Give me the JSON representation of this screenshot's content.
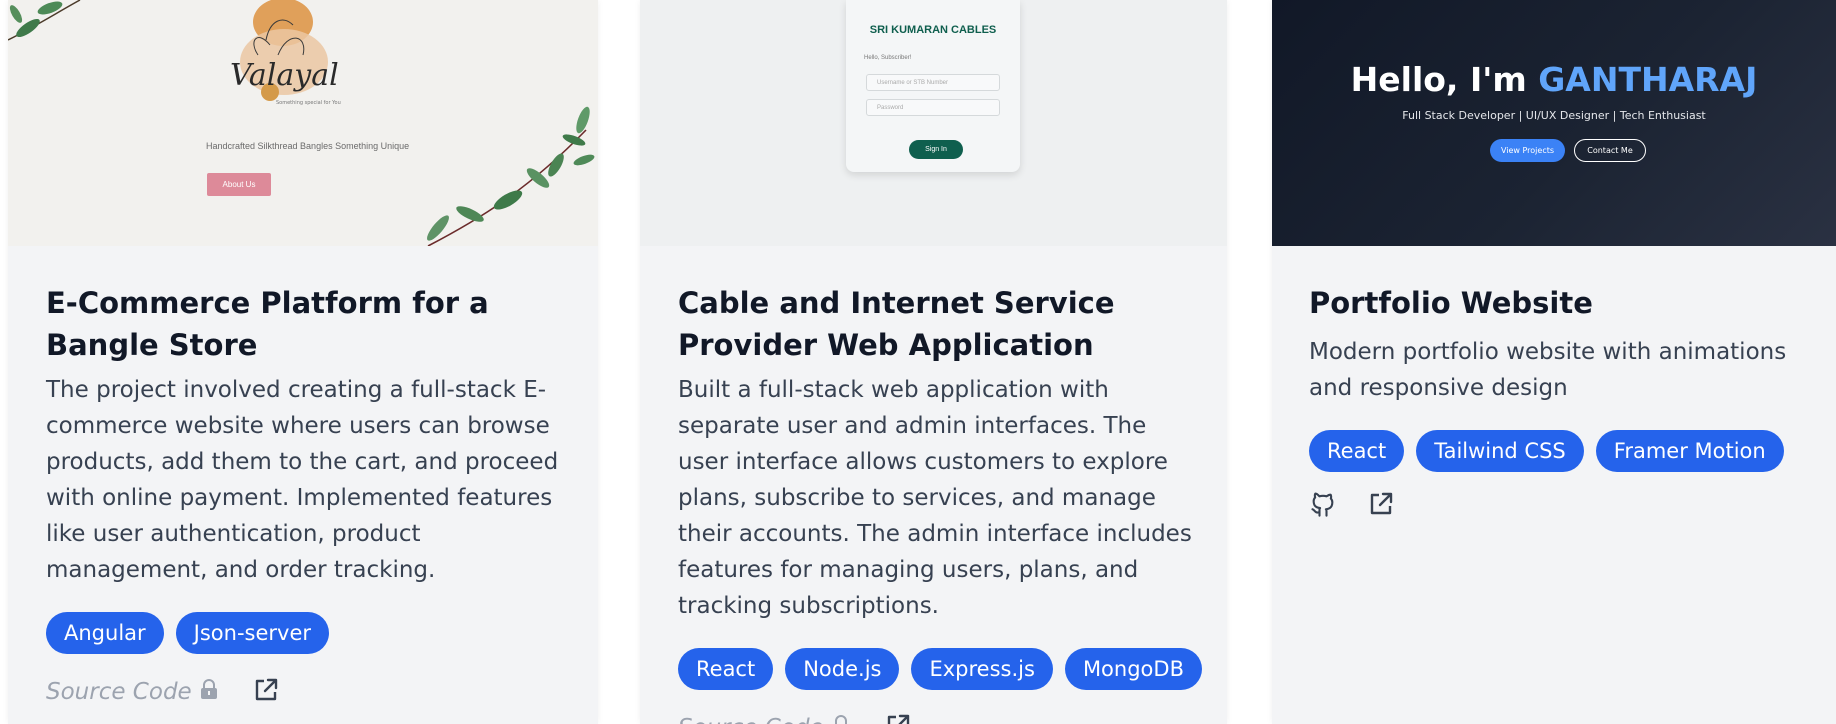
{
  "projects": [
    {
      "title": "E-Commerce Platform for a Bangle Store",
      "description": "The project involved creating a full-stack E-commerce website where users can browse products, add them to the cart, and proceed with online payment. Implemented features like user authentication, product management, and order tracking.",
      "tags": [
        "Angular",
        "Json-server"
      ],
      "source_label": "Source Code",
      "preview": {
        "brand": "Valayal",
        "brand_sub": "Something special for You",
        "tagline": "Handcrafted Silkthread Bangles Something Unique",
        "button": "About Us"
      }
    },
    {
      "title": "Cable and Internet Service Provider Web Application",
      "description": "Built a full-stack web application with separate user and admin interfaces. The user interface allows customers to explore plans, subscribe to services, and manage their accounts. The admin interface includes features for managing users, plans, and tracking subscriptions.",
      "tags": [
        "React",
        "Node.js",
        "Express.js",
        "MongoDB"
      ],
      "source_label": "Source Code",
      "preview": {
        "title": "SRI KUMARAN CABLES",
        "greeting": "Hello, Subscriber!",
        "username_placeholder": "Username or STB Number",
        "password_placeholder": "Password",
        "button": "Sign In"
      }
    },
    {
      "title": "Portfolio Website",
      "description": "Modern portfolio website with animations and responsive design",
      "tags": [
        "React",
        "Tailwind CSS",
        "Framer Motion"
      ],
      "preview": {
        "greeting": "Hello, I'm ",
        "name": "GANTHARAJ",
        "subtitle": "Full Stack Developer | UI/UX Designer | Tech Enthusiast",
        "button_primary": "View Projects",
        "button_secondary": "Contact Me"
      }
    }
  ],
  "colors": {
    "tag_bg": "#2563eb",
    "card_bg": "#f3f4f6",
    "muted": "#9ca3af",
    "cable_green": "#0f5f4e",
    "valayal_pink": "#dd8a99",
    "portfolio_accent": "#60a5fa"
  },
  "icons": [
    "lock-icon",
    "external-link-icon",
    "github-icon"
  ]
}
